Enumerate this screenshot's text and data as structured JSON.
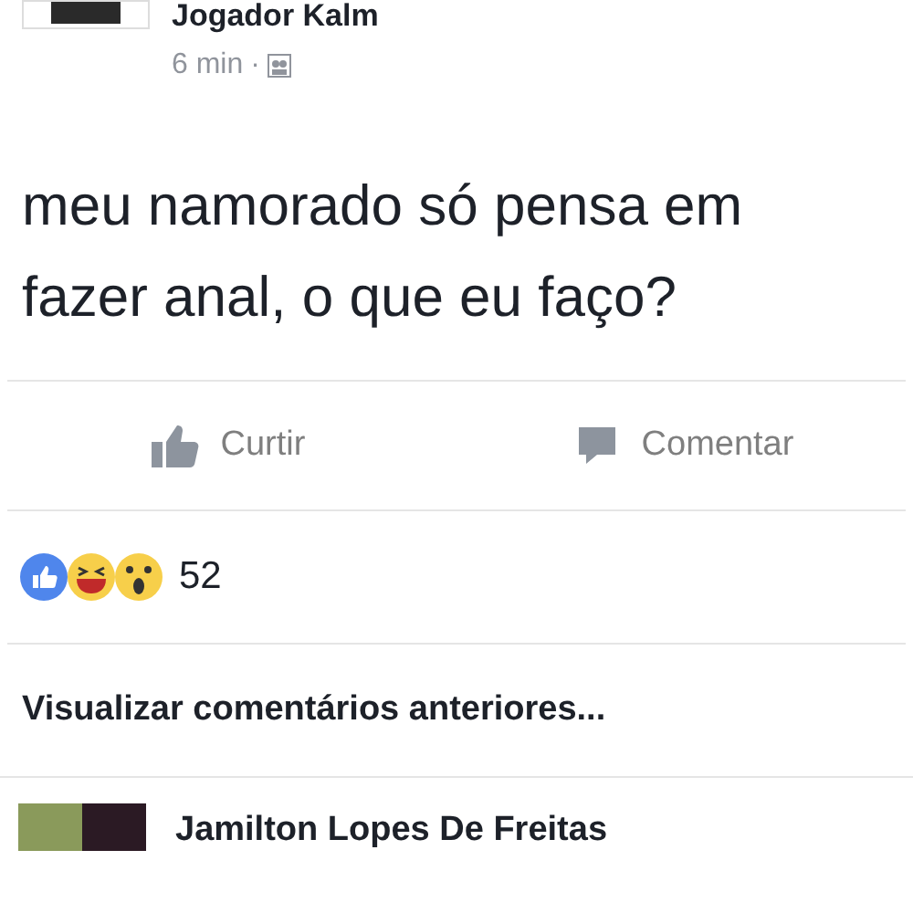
{
  "post": {
    "author": "Jogador Kalm",
    "time": "6 min",
    "separator": "·",
    "text": "meu namorado só pensa em fazer anal, o que eu faço?"
  },
  "actions": [
    {
      "kind": "like",
      "label": "Curtir"
    },
    {
      "kind": "comment",
      "label": "Comentar"
    }
  ],
  "reactions": {
    "count": "52"
  },
  "previous_comments": "Visualizar comentários anteriores...",
  "comment": {
    "author": "Jamilton Lopes De Freitas"
  }
}
